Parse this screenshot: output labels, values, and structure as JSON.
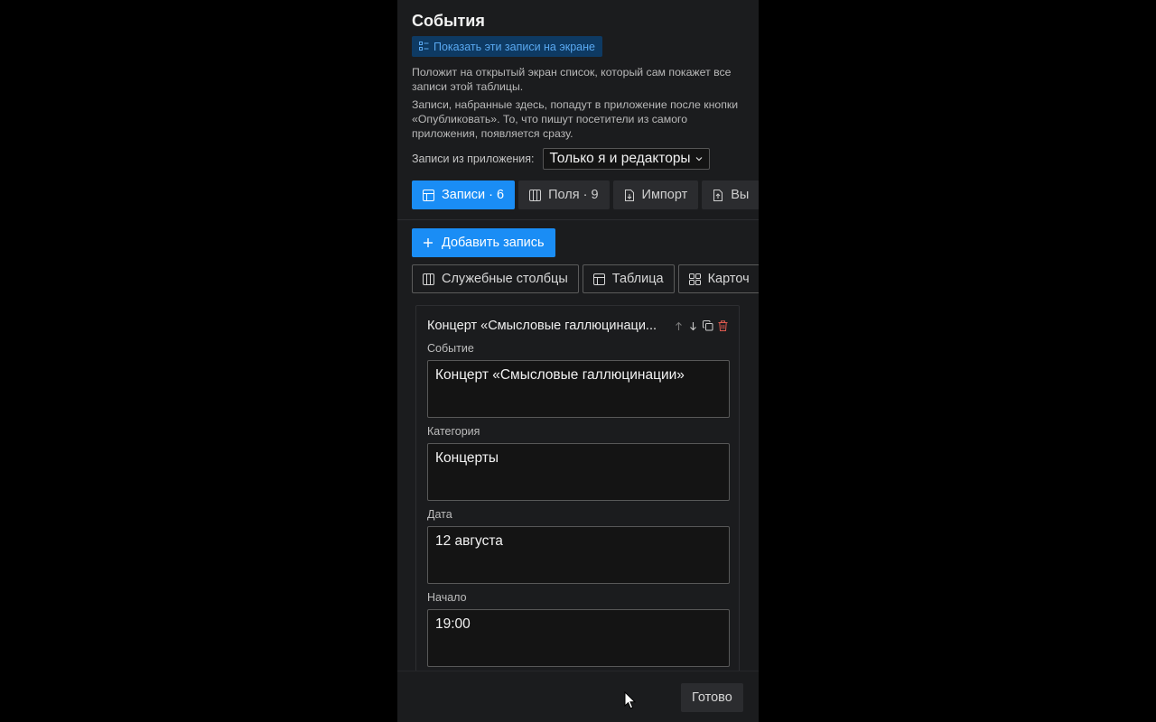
{
  "panel": {
    "title": "События",
    "show_button_label": "Показать эти записи на экране",
    "description_1": "Положит на открытый экран список, который сам покажет все записи этой таблицы.",
    "description_2": "Записи, набранные здесь, попадут в приложение после кнопки «Опубликовать». То, что пишут посетители из самого приложения, появляется сразу.",
    "setting_label": "Записи из приложения:",
    "setting_value": "Только я и редакторы"
  },
  "tabs": [
    {
      "label": "Записи · 6",
      "icon": "table-icon",
      "active": true
    },
    {
      "label": "Поля · 9",
      "icon": "columns-icon",
      "active": false
    },
    {
      "label": "Импорт",
      "icon": "file-import-icon",
      "active": false
    },
    {
      "label": "Вы",
      "icon": "file-export-icon",
      "active": false
    }
  ],
  "add_button_label": "Добавить запись",
  "views": [
    {
      "label": "Служебные столбцы",
      "icon": "columns-icon"
    },
    {
      "label": "Таблица",
      "icon": "table-icon"
    },
    {
      "label": "Карточ",
      "icon": "grid-icon"
    }
  ],
  "card": {
    "title": "Концерт «Смысловые галлюцинаци...",
    "fields": [
      {
        "label": "Событие",
        "value": "Концерт «Смысловые галлюцинации»"
      },
      {
        "label": "Категория",
        "value": "Концерты"
      },
      {
        "label": "Дата",
        "value": "12 августа"
      },
      {
        "label": "Начало",
        "value": "19:00"
      }
    ]
  },
  "footer": {
    "done_label": "Готово"
  },
  "colors": {
    "accent": "#1a8df5",
    "panel_bg": "#1b1c1e",
    "page_bg": "#000000",
    "delete": "#e05a4f"
  }
}
